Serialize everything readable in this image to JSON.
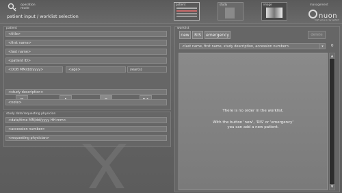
{
  "header": {
    "operation_mode": "operation\nmode",
    "title": "patient input / worklist selection",
    "thumbnails": [
      {
        "label": "patient"
      },
      {
        "label": "study"
      },
      {
        "label": "image"
      }
    ],
    "management_label": "management",
    "logo_text": "nuon",
    "logo_sub": "high value x-ray system"
  },
  "patient": {
    "section_label": "patient",
    "fields": {
      "title": "<title>",
      "first_name": "<first name>",
      "last_name": "<last name>",
      "patient_id": "<patient ID>",
      "dob": "<DOB MM/dd/yyyy>",
      "age": "<age>",
      "age_unit": "year(s)",
      "study_description": "<study description>",
      "note": "<note>"
    },
    "sex_buttons": [
      "M",
      "F",
      "",
      "N/A"
    ]
  },
  "study": {
    "section_label": "study date/requesting physician",
    "fields": {
      "datetime": "<date/time MM/dd/yyyy HH:mm>",
      "accession": "<accession number>",
      "physician": "<requesting physician>"
    }
  },
  "worklist": {
    "section_label": "worklist",
    "buttons": {
      "new": "new",
      "ris": "RIS",
      "emergency": "emergency",
      "delete": "delete"
    },
    "search_placeholder": "<last name, first name, study description, accession number>",
    "count": "0",
    "empty_message_1": "There is no order in the worklist.",
    "empty_message_2": "With the button 'new', 'RIS' or 'emergency'",
    "empty_message_3": "you can add a new patient."
  }
}
